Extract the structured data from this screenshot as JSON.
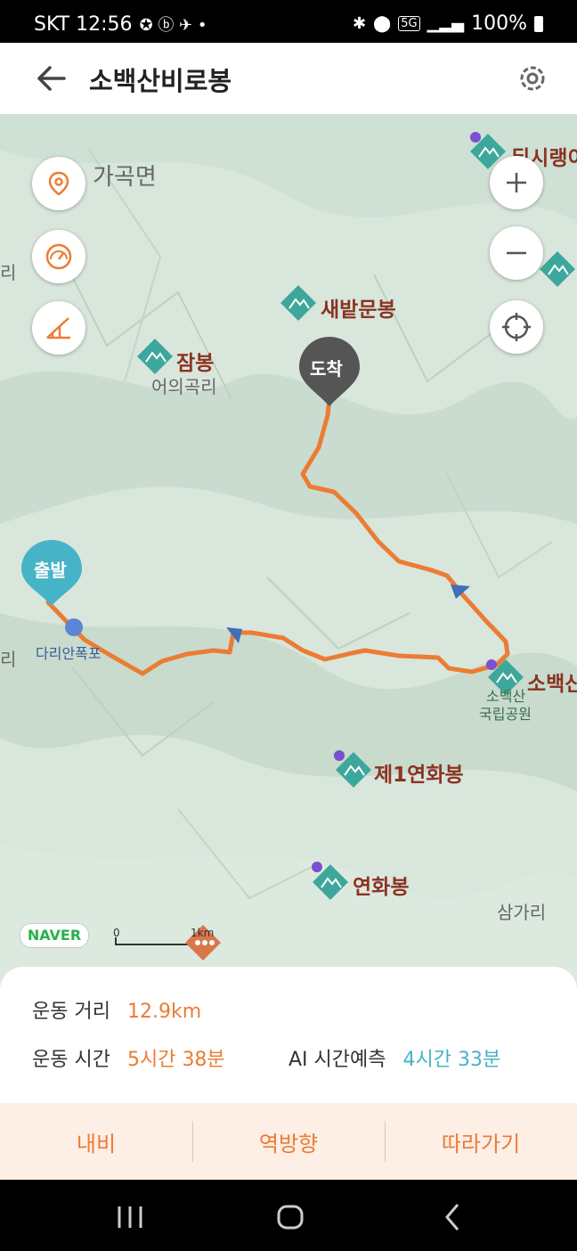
{
  "status": {
    "carrier_time": "SKT 12:56",
    "network": "5G",
    "battery": "100%"
  },
  "app": {
    "title": "소백산비로봉"
  },
  "map": {
    "labels": {
      "gagok": "가곡면",
      "dwisirang": "뒤시랭이",
      "saebatmunbong": "새밭문봉",
      "jambong": "잠봉",
      "eouigokri": "어의곡리",
      "dochak": "도착",
      "chulbal": "출발",
      "darian": "다리안폭포",
      "sobaeksan": "소백산",
      "sobaeksan_np": "소백산",
      "national_park": "국립공원",
      "je1yeonhwabong": "제1연화봉",
      "yeonhwabong": "연화봉",
      "samgari": "삼가리",
      "ri_left1": "리",
      "ri_left2": "리"
    },
    "scale": {
      "zero": "0",
      "km": "1km"
    },
    "naver": "NAVER",
    "route_color": "#ec7c34"
  },
  "stats": {
    "distance_label": "운동 거리",
    "distance_value": "12.9km",
    "time_label": "운동 시간",
    "time_value": "5시간 38분",
    "ai_label": "AI 시간예측",
    "ai_value": "4시간 33분"
  },
  "actions": {
    "navi": "내비",
    "reverse": "역방향",
    "follow": "따라가기"
  },
  "colors": {
    "accent": "#ec7c34",
    "teal": "#47b3c6",
    "peak": "#8b3322"
  }
}
